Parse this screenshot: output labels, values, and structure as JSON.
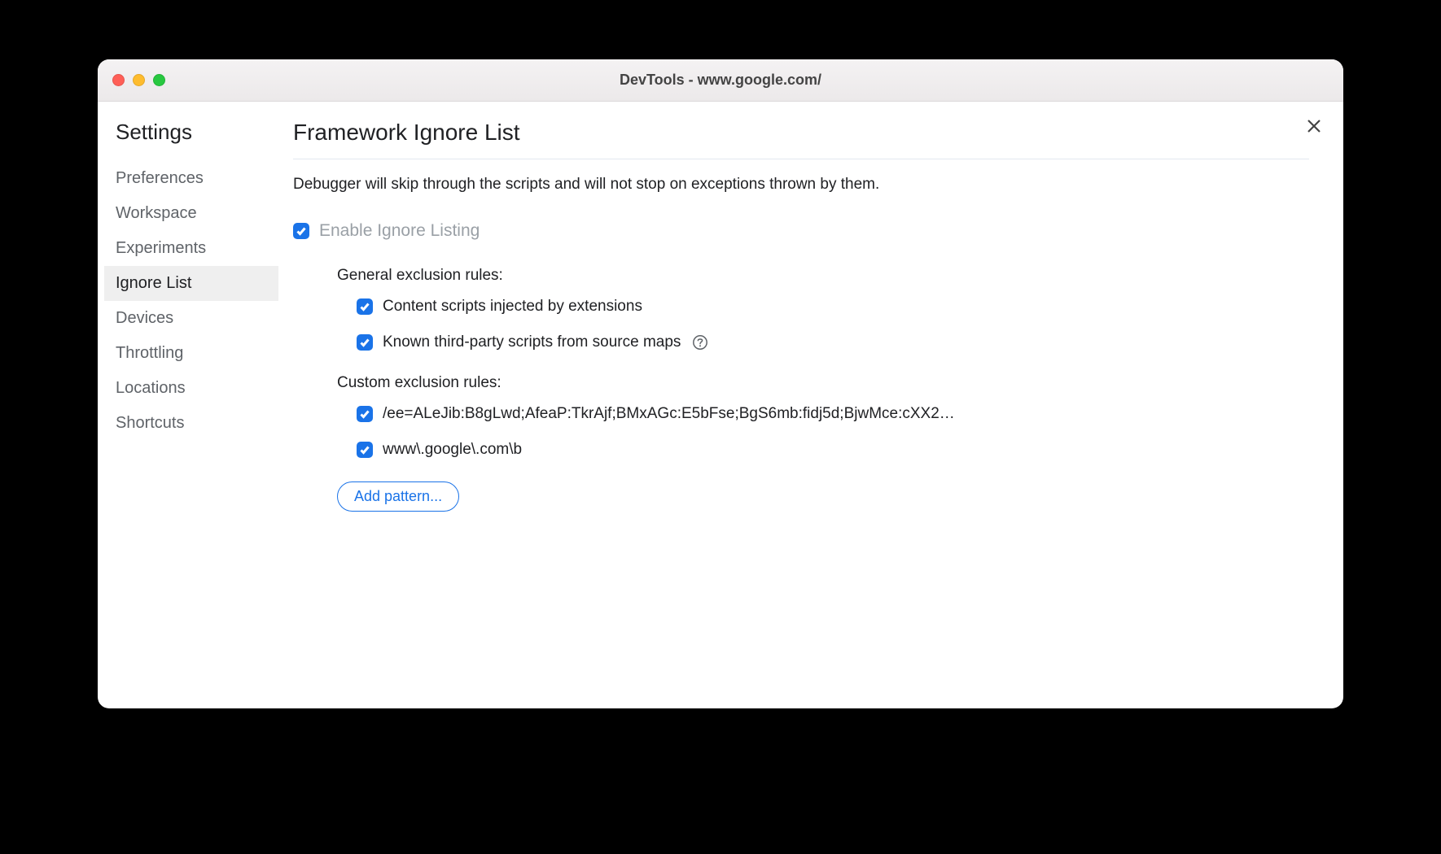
{
  "window": {
    "title": "DevTools - www.google.com/"
  },
  "sidebar": {
    "title": "Settings",
    "items": [
      {
        "label": "Preferences",
        "selected": false
      },
      {
        "label": "Workspace",
        "selected": false
      },
      {
        "label": "Experiments",
        "selected": false
      },
      {
        "label": "Ignore List",
        "selected": true
      },
      {
        "label": "Devices",
        "selected": false
      },
      {
        "label": "Throttling",
        "selected": false
      },
      {
        "label": "Locations",
        "selected": false
      },
      {
        "label": "Shortcuts",
        "selected": false
      }
    ]
  },
  "main": {
    "heading": "Framework Ignore List",
    "description": "Debugger will skip through the scripts and will not stop on exceptions thrown by them.",
    "enable_toggle": {
      "label": "Enable Ignore Listing",
      "checked": true
    },
    "general_heading": "General exclusion rules:",
    "general_rules": [
      {
        "label": "Content scripts injected by extensions",
        "checked": true,
        "help": false
      },
      {
        "label": "Known third-party scripts from source maps",
        "checked": true,
        "help": true
      }
    ],
    "custom_heading": "Custom exclusion rules:",
    "custom_rules": [
      {
        "label": "/ee=ALeJib:B8gLwd;AfeaP:TkrAjf;BMxAGc:E5bFse;BgS6mb:fidj5d;BjwMce:cXX2…",
        "checked": true
      },
      {
        "label": "www\\.google\\.com\\b",
        "checked": true
      }
    ],
    "add_pattern_label": "Add pattern..."
  }
}
